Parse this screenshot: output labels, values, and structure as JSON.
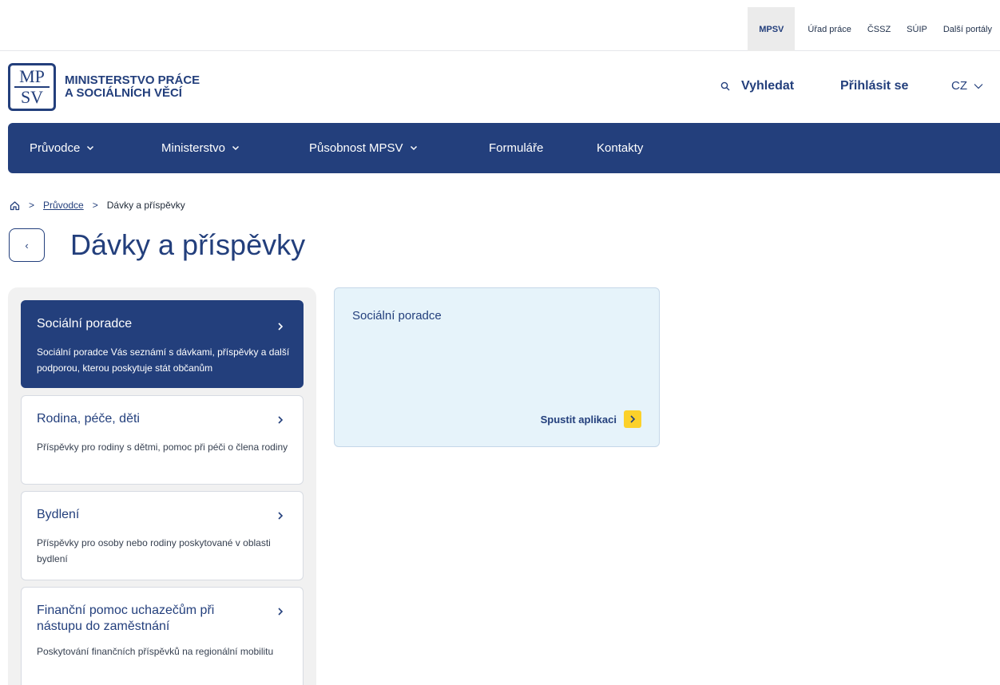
{
  "portal_links": [
    "MPSV",
    "Úřad práce",
    "ČSSZ",
    "SÚIP",
    "Další portály"
  ],
  "logo": {
    "mark_line1": "MP",
    "mark_line2": "SV",
    "text_line1": "MINISTERSTVO PRÁCE",
    "text_line2": "A SOCIÁLNÍCH VĚCÍ"
  },
  "header": {
    "search_label": "Vyhledat",
    "login_label": "Přihlásit se",
    "lang_label": "CZ"
  },
  "nav": {
    "items": [
      {
        "label": "Průvodce",
        "has_dropdown": true
      },
      {
        "label": "Ministerstvo",
        "has_dropdown": true
      },
      {
        "label": "Působnost MPSV",
        "has_dropdown": true
      },
      {
        "label": "Formuláře",
        "has_dropdown": false
      },
      {
        "label": "Kontakty",
        "has_dropdown": false
      }
    ]
  },
  "breadcrumb": {
    "parent": "Průvodce",
    "current": "Dávky a příspěvky"
  },
  "page_title": "Dávky a příspěvky",
  "sidebar": {
    "cards": [
      {
        "title": "Sociální poradce",
        "description": "Sociální poradce Vás seznámí s dávkami, příspěvky a další podporou, kterou poskytuje stát občanům",
        "active": true
      },
      {
        "title": "Rodina, péče, děti",
        "description": "Příspěvky pro rodiny s dětmi, pomoc při péči o člena rodiny",
        "active": false
      },
      {
        "title": "Bydlení",
        "description": "Příspěvky pro osoby nebo rodiny poskytované v oblasti bydlení",
        "active": false
      },
      {
        "title": "Finanční pomoc uchazečům při nástupu do zaměstnání",
        "description": "Poskytování finančních příspěvků na regionální mobilitu",
        "active": false
      }
    ]
  },
  "tile": {
    "title": "Sociální poradce",
    "action_label": "Spustit aplikaci"
  },
  "colors": {
    "brand_blue": "#233f7c",
    "tile_bg": "#e6f3fa",
    "action_yellow": "#fcd12a",
    "sidebar_bg": "#f1f1f1"
  }
}
